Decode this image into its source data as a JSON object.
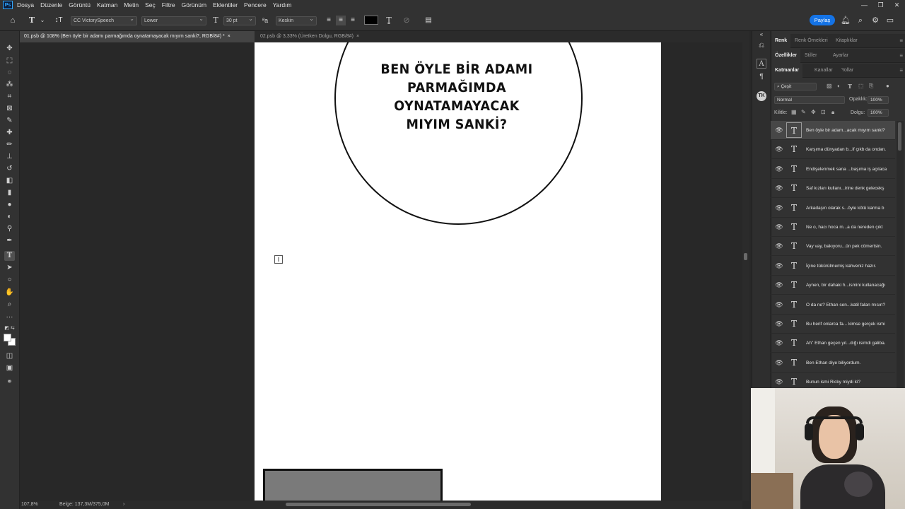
{
  "menubar": {
    "logo": "Ps",
    "items": [
      "Dosya",
      "Düzenle",
      "Görüntü",
      "Katman",
      "Metin",
      "Seç",
      "Filtre",
      "Görünüm",
      "Eklentiler",
      "Pencere",
      "Yardım"
    ],
    "window_controls": [
      "—",
      "❐",
      "✕"
    ]
  },
  "options": {
    "font_family": "CC VictorySpeech",
    "font_style": "Lower",
    "font_size": "30 pt",
    "antialias": "Keskin",
    "text_color": "#000000",
    "share_label": "Paylaş"
  },
  "tabs": [
    {
      "label": "01.psb @ 108% (Ben öyle bir adamı parmağımda oynatamayacak mıyım sanki?, RGB/8#) *",
      "close": "×"
    },
    {
      "label": "02.psb @ 3,33% (Üretken Dolgu, RGB/8#)",
      "close": "×"
    }
  ],
  "canvas": {
    "bubble_lines": [
      "BEN ÖYLE BİR ADAMI",
      "PARMAĞIMDA OYNATAMAYACAK",
      "MIYIM SANKİ?"
    ]
  },
  "status": {
    "zoom": "107,8%",
    "doc_info": "Belge: 137,3M/375,0M",
    "arrow": "›"
  },
  "panels": {
    "top_tabs": [
      "Renk",
      "Renk Örnekleri",
      "Kitaplıklar"
    ],
    "mid_tabs": [
      "Özellikler",
      "Stiller",
      "Ayarlar"
    ],
    "layer_tabs": [
      "Katmanlar",
      "Kanallar",
      "Yollar"
    ],
    "filter_label": "Çeşit",
    "blend_mode": "Normal",
    "opacity_label": "Opaklık:",
    "opacity_value": "100%",
    "lock_label": "Kilitle:",
    "fill_label": "Dolgu:",
    "fill_value": "100%"
  },
  "layers": [
    {
      "name": "Ben öyle bir adam...acak mıyım sanki?",
      "selected": true
    },
    {
      "name": "Karşıma dünyadan b...if çıkb da ondan.",
      "selected": false
    },
    {
      "name": "Endişelenmek sana ...başıma iş açılaca",
      "selected": false
    },
    {
      "name": "Saf kızları kullanı...irine denk gelecekş",
      "selected": false
    },
    {
      "name": "Arkadaşın olarak s...öyle kötü karma b",
      "selected": false
    },
    {
      "name": "Ne o, hacı hoca m...a da nereden çıkt",
      "selected": false
    },
    {
      "name": "Vay vay, bakıyoru...ün pek cömertsin.",
      "selected": false
    },
    {
      "name": "İçine tükürülmemiş kahveniz hazır.",
      "selected": false
    },
    {
      "name": "Aynen, bir dahaki h...ismini kullanacağı",
      "selected": false
    },
    {
      "name": "O da ne? Ethan sen...katil falan mısın?",
      "selected": false
    },
    {
      "name": "Bu herif onlarca fa... kimse gerçek ismi",
      "selected": false
    },
    {
      "name": "Ah\" Ethan geçen yıl...dığı isimdi galiba.",
      "selected": false
    },
    {
      "name": "Ben Ethan diye biliyordum.",
      "selected": false
    },
    {
      "name": "Bunun ismi Ricky miydi ki?",
      "selected": false
    }
  ]
}
